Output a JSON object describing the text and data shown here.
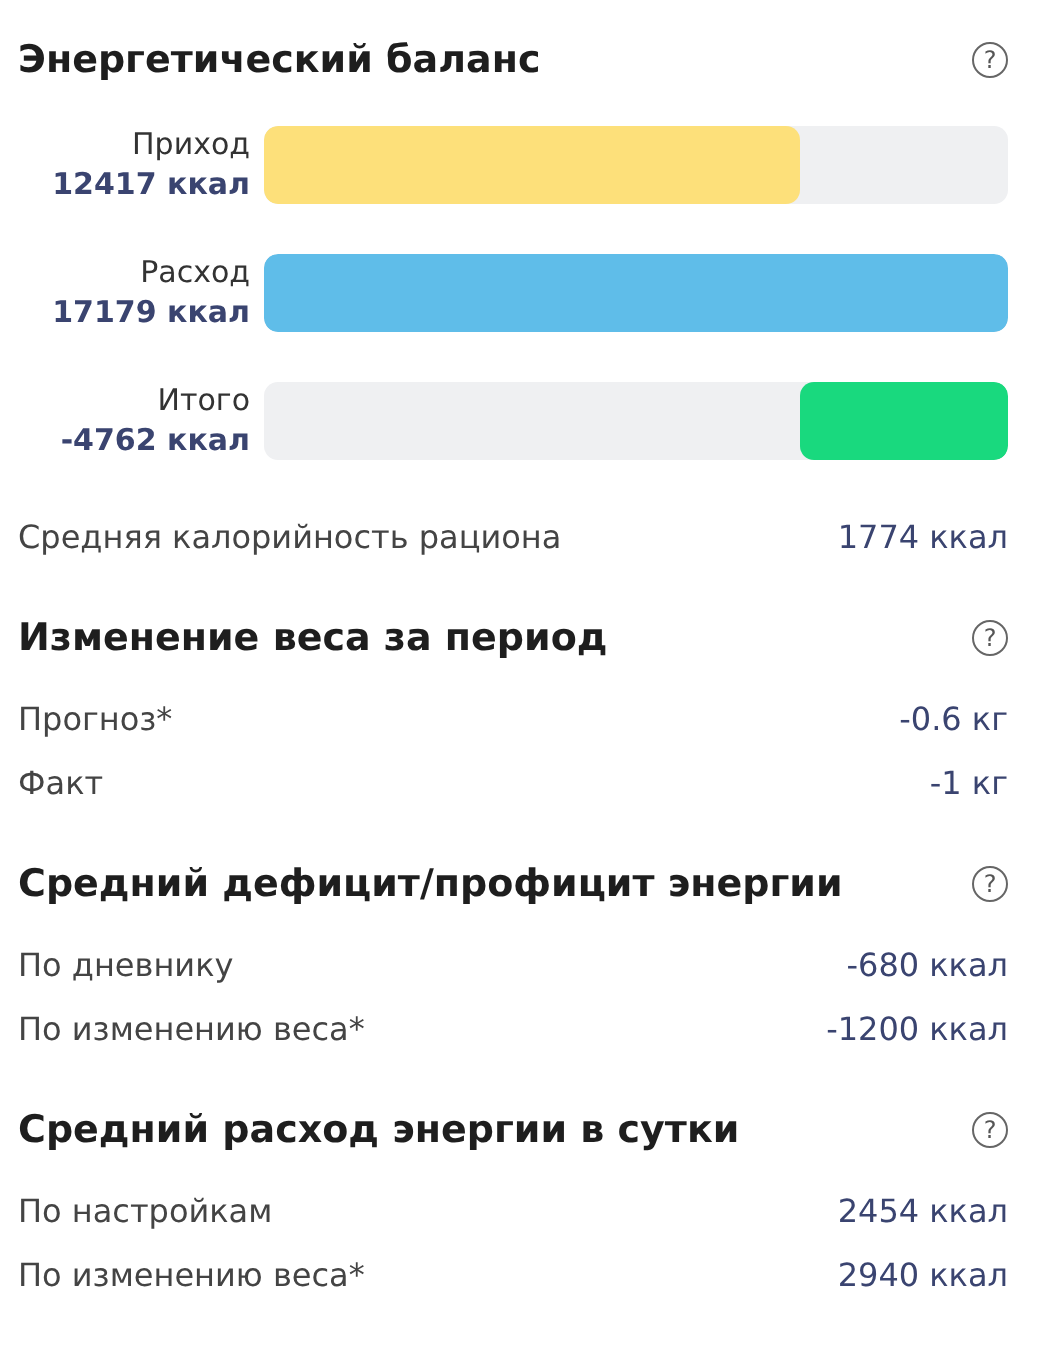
{
  "balance": {
    "title": "Энергетический баланс",
    "help": "?",
    "bars": [
      {
        "label": "Приход",
        "value": "12417 ккал",
        "color": "#fde07a",
        "level": 0.72
      },
      {
        "label": "Расход",
        "value": "17179 ккал",
        "color": "#5fbde9",
        "level": 1
      },
      {
        "label": "Итого",
        "value": "-4762 ккал",
        "color": "#19d97e",
        "from_end": true,
        "level": 0.28
      }
    ],
    "rows": [
      {
        "label": "Средняя калорийность рациона",
        "value": "1774 ккал"
      }
    ]
  },
  "sections": [
    {
      "title": "Изменение веса за период",
      "help": "?",
      "rows": [
        {
          "label": "Прогноз*",
          "value": "-0.6 кг"
        },
        {
          "label": "Факт",
          "value": "-1 кг"
        }
      ]
    },
    {
      "title": "Средний дефицит/профицит энергии",
      "help": "?",
      "rows": [
        {
          "label": "По дневнику",
          "value": "-680 ккал"
        },
        {
          "label": "По изменению веса*",
          "value": "-1200 ккал"
        }
      ]
    },
    {
      "title": "Средний расход энергии в сутки",
      "help": "?",
      "rows": [
        {
          "label": "По настройкам",
          "value": "2454 ккал"
        },
        {
          "label": "По изменению веса*",
          "value": "2940 ккал"
        }
      ]
    }
  ]
}
